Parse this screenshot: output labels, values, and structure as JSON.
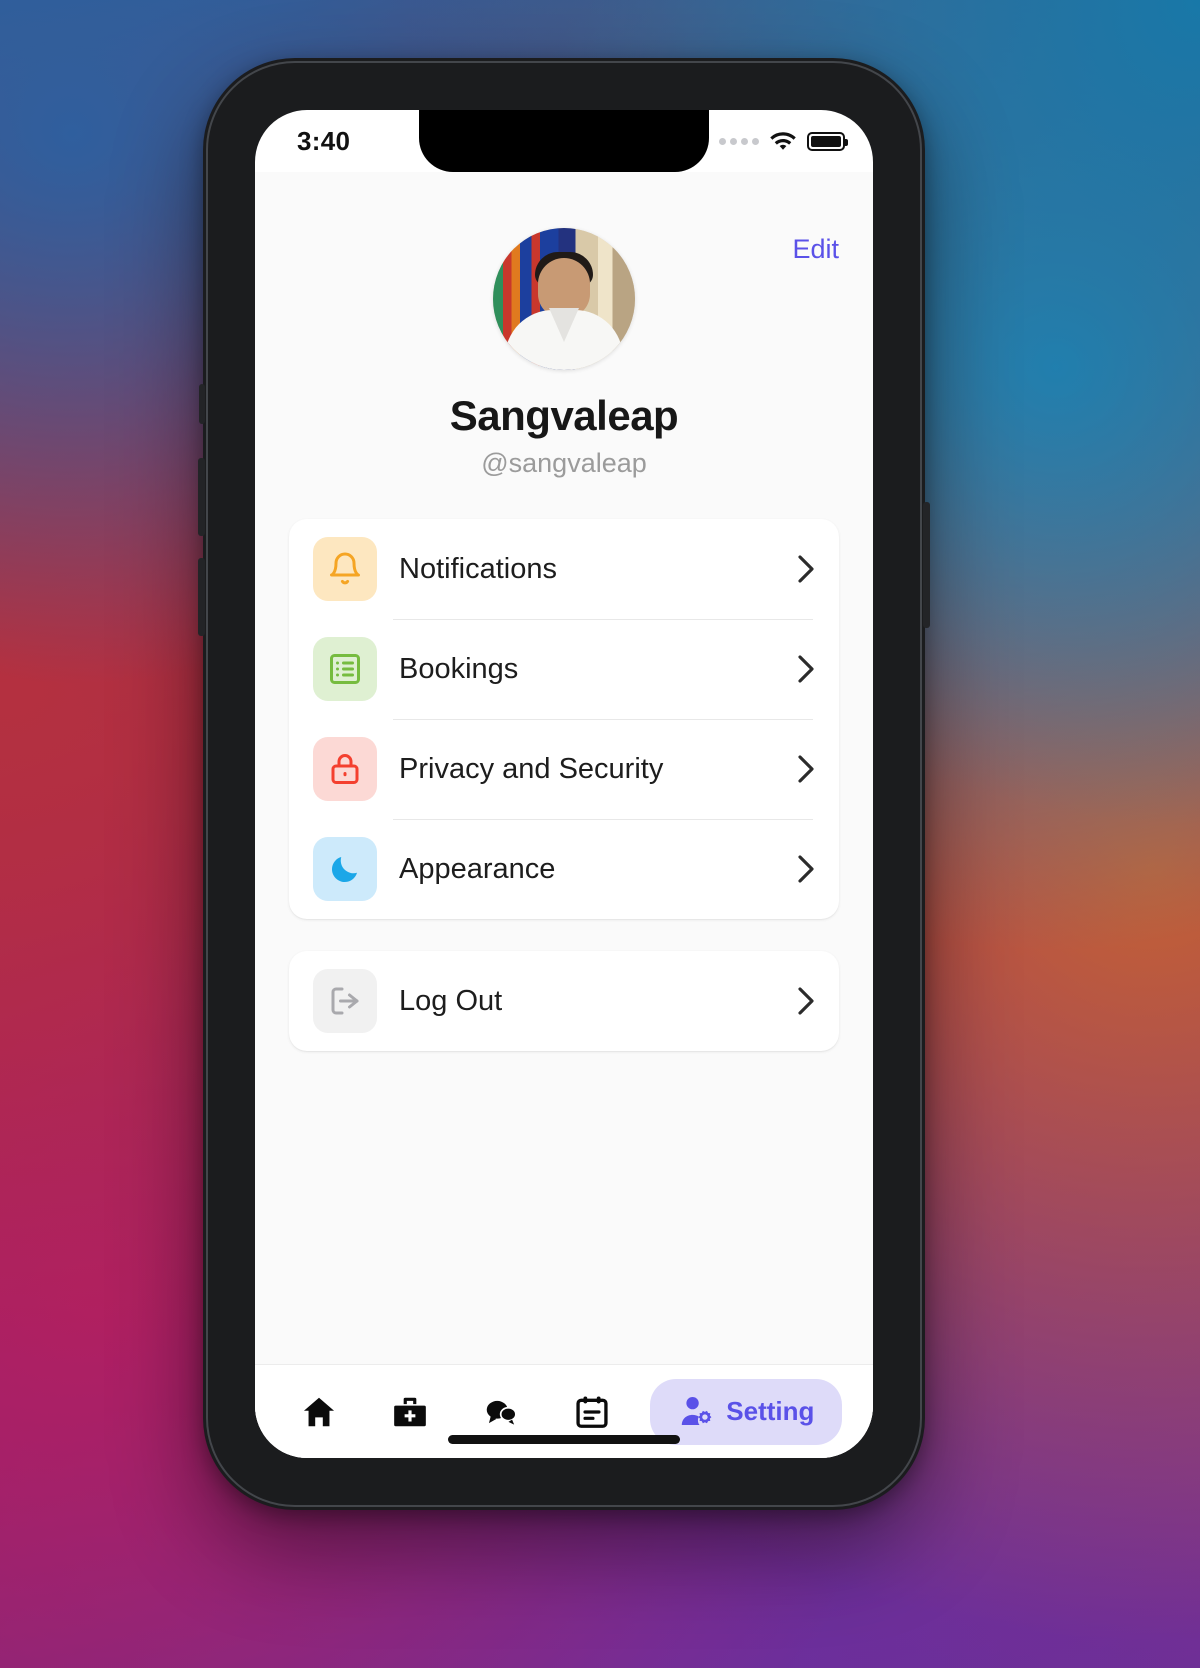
{
  "statusbar": {
    "time": "3:40",
    "signal_icon": "signal-dots-icon",
    "wifi_icon": "wifi-icon",
    "battery_icon": "battery-full-icon"
  },
  "header": {
    "edit_label": "Edit"
  },
  "profile": {
    "avatar_name": "profile-avatar",
    "display_name": "Sangvaleap",
    "handle": "@sangvaleap"
  },
  "menu": {
    "items": [
      {
        "label": "Notifications",
        "icon": "bell-icon",
        "icon_color": "#F5A524",
        "icon_bg": "#FDE7C0",
        "chevron": "chevron-right-icon"
      },
      {
        "label": "Bookings",
        "icon": "list-box-icon",
        "icon_color": "#76BC3F",
        "icon_bg": "#DFF0D2",
        "chevron": "chevron-right-icon"
      },
      {
        "label": "Privacy and Security",
        "icon": "lock-icon",
        "icon_color": "#F4402F",
        "icon_bg": "#FCD9D5",
        "chevron": "chevron-right-icon"
      },
      {
        "label": "Appearance",
        "icon": "moon-icon",
        "icon_color": "#1BA7E8",
        "icon_bg": "#CDEAFB",
        "chevron": "chevron-right-icon"
      }
    ]
  },
  "logout": {
    "label": "Log Out",
    "icon": "logout-icon",
    "icon_color": "#A9A9AD",
    "icon_bg": "#F1F1F1",
    "chevron": "chevron-right-icon"
  },
  "tabbar": {
    "items": [
      {
        "label": "",
        "icon": "home-icon",
        "active": false
      },
      {
        "label": "",
        "icon": "medical-bag-icon",
        "active": false
      },
      {
        "label": "",
        "icon": "chat-bubbles-icon",
        "active": false
      },
      {
        "label": "",
        "icon": "calendar-note-icon",
        "active": false
      },
      {
        "label": "Setting",
        "icon": "user-settings-icon",
        "active": true
      }
    ],
    "active_bg": "#DEDBF9",
    "active_color": "#5A51E8"
  },
  "theme": {
    "accent": "#5A51E8",
    "page_bg": "#FAFAFA",
    "card_bg": "#FFFFFF",
    "text_primary": "#1D1D1D",
    "text_muted": "#9B9B9B"
  }
}
